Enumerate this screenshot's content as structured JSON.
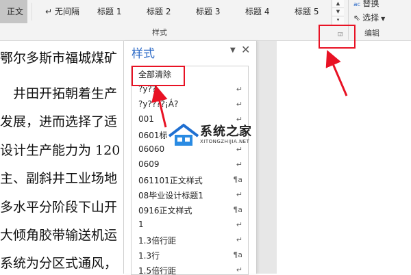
{
  "ribbon": {
    "styles_gallery": [
      {
        "label": "正文",
        "selected": true
      },
      {
        "label": "↵ 无间隔",
        "selected": false
      },
      {
        "label": "标题 1",
        "selected": false
      },
      {
        "label": "标题 2",
        "selected": false
      },
      {
        "label": "标题 3",
        "selected": false
      },
      {
        "label": "标题 4",
        "selected": false
      },
      {
        "label": "标题 5",
        "selected": false
      }
    ],
    "styles_group_label": "样式",
    "edit_group": {
      "replace_label": "替换",
      "select_label": "选择",
      "group_label": "编辑"
    }
  },
  "document": {
    "lines": [
      "鄂尔多斯市福城煤矿",
      "　井田开拓朝着生产",
      "发展，进而选择了适",
      "设计生产能力为 120",
      "主、副斜井工业场地",
      "多水平分阶段下山开",
      "大倾角胶带输送机运",
      "系统为分区式通风，"
    ]
  },
  "styles_pane": {
    "title": "样式",
    "menu_glyph": "▼",
    "close_glyph": "✕",
    "items": [
      {
        "label": "全部清除",
        "indicator": ""
      },
      {
        "label": "?y??",
        "indicator": "↵"
      },
      {
        "label": "?y????¡Á?",
        "indicator": "↵"
      },
      {
        "label": "001",
        "indicator": "↵"
      },
      {
        "label": "0601标",
        "indicator": "↵"
      },
      {
        "label": "06060",
        "indicator": "↵"
      },
      {
        "label": "0609",
        "indicator": "↵"
      },
      {
        "label": "061101正文样式",
        "indicator": "¶a"
      },
      {
        "label": "08毕业设计标题1",
        "indicator": "↵"
      },
      {
        "label": "0916正文样式",
        "indicator": "¶a"
      },
      {
        "label": "1",
        "indicator": "↵"
      },
      {
        "label": "1.3倍行距",
        "indicator": "↵"
      },
      {
        "label": "1.3行",
        "indicator": "¶a"
      },
      {
        "label": "1.5倍行距",
        "indicator": "↵"
      }
    ]
  },
  "watermark": {
    "name": "系统之家",
    "url": "XITONGZHIJIA.NET"
  },
  "colors": {
    "accent": "#2e6bc7",
    "annotation": "#e81224"
  }
}
